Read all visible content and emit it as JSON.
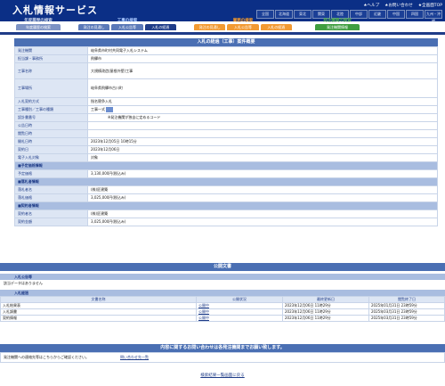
{
  "header": {
    "title": "入札情報サービス",
    "links": [
      "★ヘルプ",
      "★お問い合わせ",
      "★全画面TOP"
    ],
    "regions": [
      "全国",
      "北海道",
      "東北",
      "関東",
      "北陸",
      "中部",
      "近畿",
      "中国",
      "四国",
      "九州・沖縄"
    ]
  },
  "nav": {
    "g1": {
      "label": "年度履歴の検索",
      "btns": [
        "年度履歴の検索"
      ]
    },
    "g2": {
      "label": "工事の検索",
      "btns": [
        "発注の見通し",
        "入札公告等",
        "入札の経過"
      ]
    },
    "g3": {
      "label": "業務の検索",
      "btns": [
        "発注の見通し",
        "入札公告等",
        "入札の経過"
      ]
    },
    "g4": {
      "label": "発注機関の検索",
      "btns": [
        "発注機関情報"
      ]
    }
  },
  "detail": {
    "heading": "入札の経過（工事）案件概要",
    "rows": [
      {
        "label": "発注機関",
        "value": "岐阜県市町村共同電子入札システム"
      },
      {
        "label": "担当課・事務所",
        "value": "飛驒市"
      },
      {
        "label": "工事名称",
        "value": "大規模改造(屋根外壁)工事"
      },
      {
        "label": "工事場所",
        "value": "岐阜県飛驒市古川町"
      },
      {
        "label": "入札契約方式",
        "value": "指名競争入札"
      },
      {
        "label": "工事種別／工事の種類",
        "value": "工事一式"
      },
      {
        "label": "設計書番号",
        "value": "※発注機関が独自に定めるコード"
      },
      {
        "label": "公告日時",
        "value": ""
      },
      {
        "label": "閲覧日時",
        "value": ""
      },
      {
        "label": "開札日時",
        "value": "2023年12月05日 10時15分"
      },
      {
        "label": "契約日",
        "value": "2023年12月06日"
      },
      {
        "label": "電子入札対象",
        "value": "対象"
      }
    ],
    "sec_estimate": "■予定価格情報",
    "estimate": {
      "label": "予定価格",
      "value": "3,130,000円(税込み)"
    },
    "sec_winner": "■落札者情報",
    "winner": [
      {
        "label": "落札者名",
        "value": "(株)匠建築"
      },
      {
        "label": "落札価格",
        "value": "3,025,000円(税込み)"
      }
    ],
    "sec_contract": "■契約者情報",
    "contract": [
      {
        "label": "契約者名",
        "value": "(株)匠建築"
      },
      {
        "label": "契約金額",
        "value": "3,025,000円(税込み)"
      }
    ]
  },
  "docs": {
    "heading": "公開文書",
    "notice_head": "入札公告等",
    "notice_text": "該当データはありません",
    "progress_head": "入札経過",
    "cols": [
      "文書名称",
      "公開状況",
      "最終更新日",
      "閲覧終了日"
    ],
    "rows": [
      {
        "name": "入札結果表",
        "status": "公開中",
        "updated": "2023年12月06日 11時29分",
        "end": "2025年01月31日 23時59分"
      },
      {
        "name": "入札調書",
        "status": "公開中",
        "updated": "2023年12月06日 11時29分",
        "end": "2025年03月31日 23時59分"
      },
      {
        "name": "契約情報",
        "status": "公開中",
        "updated": "2023年12月06日 11時29分",
        "end": "2025年03月31日 23時59分"
      }
    ]
  },
  "inquiry": {
    "heading": "内容に関するお問い合わせは各発注機関までお願い致します。",
    "text": "発注機関への連絡先等はこちらからご確認ください。",
    "link": "問い合わせ先一覧"
  },
  "back": "検索結果一覧画面に戻る"
}
